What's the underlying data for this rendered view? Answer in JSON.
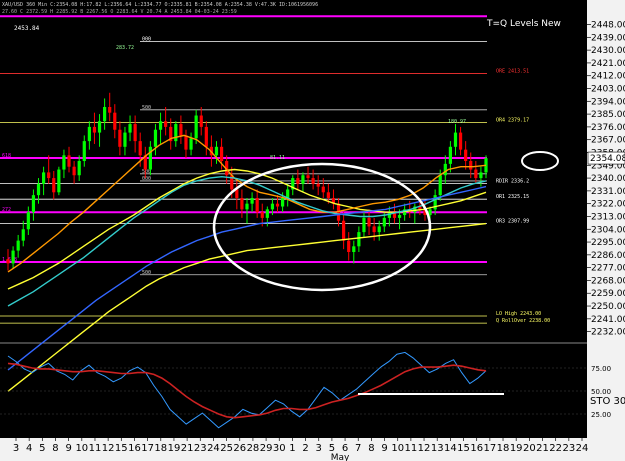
{
  "header": {
    "symbol_line": "XAU/USD 360 Min  C:2354.08  H:17.82  L:2356.64  L:2334.77  O:2335.81  B:2354.08  A:2354.38  V:47.3K  ID:1061956096",
    "sub_line": "27.60  C 2372.59  H 2285.92  B 2267.56  O 2283.64  V 20.74  A 2453.84  04-03-24  23:59",
    "top_left_value": "2453.84",
    "indicator_title": "T=Q Levels New"
  },
  "colors": {
    "background": "#000000",
    "up_candle": "#00ff00",
    "down_candle": "#ff0000",
    "pivot_line": "#ff00ff",
    "ema_yellow": "#ffff33",
    "ema_orange": "#ff9900",
    "ema_green": "#99cc33",
    "ema_cyan": "#33cccc",
    "ema_blue": "#3366ff",
    "annotation": "#ffffff",
    "stoch_fast": "#3399ff",
    "stoch_slow": "#cc2222"
  },
  "chart_data": [
    {
      "type": "candlestick",
      "title": "XAU/USD 360 Min",
      "ylim": [
        2224,
        2454
      ],
      "y_ticks": [
        2448.0,
        2439.0,
        2430.0,
        2421.0,
        2412.0,
        2403.0,
        2394.0,
        2385.0,
        2376.0,
        2367.0,
        2358.0,
        2349.0,
        2340.0,
        2331.0,
        2322.0,
        2313.0,
        2304.0,
        2295.0,
        2286.0,
        2277.0,
        2268.0,
        2259.0,
        2250.0,
        2241.0,
        2232.0
      ],
      "last_price_label": "2354.08",
      "x_dates": [
        "3",
        "4",
        "5",
        "8",
        "9",
        "10",
        "11",
        "12",
        "15",
        "16",
        "17",
        "18",
        "19",
        "21",
        "23",
        "24",
        "25",
        "26",
        "28",
        "29",
        "30",
        "1",
        "2",
        "3",
        "5",
        "6",
        "7",
        "8",
        "9",
        "10",
        "11",
        "12",
        "13",
        "14",
        "15",
        "16",
        "17",
        "18",
        "19",
        "20",
        "21",
        "22",
        "23",
        "24"
      ],
      "x_month_label": "May",
      "candles": [
        [
          2283,
          2290,
          2275,
          2280
        ],
        [
          2280,
          2292,
          2276,
          2289
        ],
        [
          2289,
          2300,
          2284,
          2296
        ],
        [
          2296,
          2310,
          2292,
          2304
        ],
        [
          2304,
          2320,
          2300,
          2316
        ],
        [
          2316,
          2332,
          2310,
          2328
        ],
        [
          2328,
          2340,
          2322,
          2336
        ],
        [
          2336,
          2348,
          2328,
          2344
        ],
        [
          2344,
          2356,
          2336,
          2340
        ],
        [
          2340,
          2345,
          2325,
          2330
        ],
        [
          2330,
          2348,
          2328,
          2346
        ],
        [
          2346,
          2360,
          2340,
          2356
        ],
        [
          2356,
          2362,
          2344,
          2348
        ],
        [
          2348,
          2352,
          2336,
          2342
        ],
        [
          2342,
          2356,
          2338,
          2352
        ],
        [
          2352,
          2370,
          2348,
          2366
        ],
        [
          2366,
          2380,
          2360,
          2376
        ],
        [
          2376,
          2386,
          2364,
          2372
        ],
        [
          2372,
          2385,
          2362,
          2380
        ],
        [
          2380,
          2396,
          2374,
          2390
        ],
        [
          2390,
          2400,
          2380,
          2386
        ],
        [
          2386,
          2392,
          2368,
          2374
        ],
        [
          2374,
          2380,
          2356,
          2362
        ],
        [
          2362,
          2376,
          2356,
          2372
        ],
        [
          2372,
          2384,
          2366,
          2378
        ],
        [
          2378,
          2384,
          2358,
          2366
        ],
        [
          2366,
          2372,
          2348,
          2356
        ],
        [
          2356,
          2362,
          2340,
          2346
        ],
        [
          2346,
          2366,
          2342,
          2362
        ],
        [
          2362,
          2378,
          2356,
          2374
        ],
        [
          2374,
          2386,
          2364,
          2380
        ],
        [
          2380,
          2390,
          2370,
          2376
        ],
        [
          2376,
          2382,
          2360,
          2366
        ],
        [
          2366,
          2380,
          2362,
          2378
        ],
        [
          2378,
          2384,
          2364,
          2370
        ],
        [
          2370,
          2374,
          2354,
          2360
        ],
        [
          2360,
          2372,
          2356,
          2368
        ],
        [
          2368,
          2388,
          2364,
          2384
        ],
        [
          2384,
          2390,
          2370,
          2376
        ],
        [
          2376,
          2380,
          2356,
          2362
        ],
        [
          2362,
          2370,
          2348,
          2356
        ],
        [
          2356,
          2366,
          2350,
          2362
        ],
        [
          2362,
          2368,
          2346,
          2352
        ],
        [
          2352,
          2356,
          2336,
          2342
        ],
        [
          2342,
          2348,
          2326,
          2332
        ],
        [
          2332,
          2338,
          2318,
          2326
        ],
        [
          2326,
          2332,
          2312,
          2318
        ],
        [
          2318,
          2326,
          2308,
          2322
        ],
        [
          2322,
          2330,
          2316,
          2326
        ],
        [
          2326,
          2332,
          2312,
          2316
        ],
        [
          2316,
          2322,
          2306,
          2312
        ],
        [
          2312,
          2320,
          2306,
          2318
        ],
        [
          2318,
          2326,
          2314,
          2322
        ],
        [
          2322,
          2328,
          2316,
          2320
        ],
        [
          2320,
          2330,
          2316,
          2326
        ],
        [
          2326,
          2336,
          2320,
          2332
        ],
        [
          2332,
          2342,
          2328,
          2340
        ],
        [
          2340,
          2346,
          2332,
          2336
        ],
        [
          2336,
          2344,
          2330,
          2342
        ],
        [
          2342,
          2348,
          2336,
          2340
        ],
        [
          2340,
          2346,
          2332,
          2336
        ],
        [
          2336,
          2342,
          2328,
          2334
        ],
        [
          2334,
          2340,
          2326,
          2330
        ],
        [
          2330,
          2336,
          2322,
          2326
        ],
        [
          2326,
          2332,
          2318,
          2322
        ],
        [
          2322,
          2326,
          2306,
          2310
        ],
        [
          2310,
          2316,
          2290,
          2296
        ],
        [
          2296,
          2302,
          2282,
          2288
        ],
        [
          2288,
          2296,
          2280,
          2292
        ],
        [
          2292,
          2306,
          2288,
          2302
        ],
        [
          2302,
          2316,
          2298,
          2312
        ],
        [
          2312,
          2318,
          2300,
          2306
        ],
        [
          2306,
          2312,
          2296,
          2302
        ],
        [
          2302,
          2310,
          2296,
          2306
        ],
        [
          2306,
          2316,
          2302,
          2312
        ],
        [
          2312,
          2320,
          2306,
          2316
        ],
        [
          2316,
          2322,
          2308,
          2312
        ],
        [
          2312,
          2318,
          2304,
          2314
        ],
        [
          2314,
          2322,
          2310,
          2318
        ],
        [
          2318,
          2324,
          2312,
          2316
        ],
        [
          2316,
          2322,
          2308,
          2320
        ],
        [
          2320,
          2326,
          2314,
          2318
        ],
        [
          2318,
          2324,
          2310,
          2314
        ],
        [
          2314,
          2320,
          2308,
          2318
        ],
        [
          2318,
          2332,
          2314,
          2328
        ],
        [
          2328,
          2346,
          2324,
          2342
        ],
        [
          2342,
          2356,
          2336,
          2350
        ],
        [
          2350,
          2366,
          2344,
          2362
        ],
        [
          2362,
          2378,
          2356,
          2372
        ],
        [
          2372,
          2376,
          2356,
          2360
        ],
        [
          2360,
          2366,
          2346,
          2352
        ],
        [
          2352,
          2358,
          2340,
          2346
        ],
        [
          2346,
          2352,
          2336,
          2340
        ],
        [
          2340,
          2348,
          2334,
          2344
        ],
        [
          2344,
          2356,
          2340,
          2354
        ]
      ],
      "moving_averages": [
        {
          "name": "EMA yellow",
          "values": [
            2262,
            2266,
            2270,
            2275,
            2280,
            2286,
            2292,
            2298,
            2304,
            2309,
            2314,
            2320,
            2326,
            2331,
            2336,
            2340,
            2343,
            2345,
            2346,
            2345,
            2343,
            2340,
            2336,
            2332,
            2328,
            2325,
            2322,
            2320,
            2318,
            2317,
            2316,
            2316,
            2317,
            2318,
            2320,
            2322,
            2324,
            2327,
            2330
          ]
        },
        {
          "name": "EMA orange",
          "values": [
            2274,
            2280,
            2287,
            2294,
            2301,
            2309,
            2316,
            2324,
            2332,
            2340,
            2348,
            2356,
            2363,
            2368,
            2370,
            2367,
            2360,
            2350,
            2340,
            2334,
            2330,
            2328,
            2326,
            2322,
            2318,
            2316,
            2316,
            2318,
            2320,
            2322,
            2323,
            2325,
            2328,
            2333,
            2340,
            2346,
            2348,
            2348,
            2349
          ]
        },
        {
          "name": "EMA cyan",
          "values": [
            2250,
            2255,
            2260,
            2266,
            2272,
            2278,
            2284,
            2291,
            2298,
            2305,
            2312,
            2318,
            2324,
            2330,
            2335,
            2338,
            2340,
            2341,
            2340,
            2338,
            2335,
            2331,
            2327,
            2323,
            2320,
            2317,
            2315,
            2314,
            2313,
            2313,
            2314,
            2316,
            2318,
            2321,
            2325,
            2329,
            2333,
            2336,
            2338
          ]
        },
        {
          "name": "EMA blue",
          "values": [
            2205,
            2212,
            2219,
            2226,
            2233,
            2240,
            2247,
            2254,
            2260,
            2266,
            2272,
            2278,
            2283,
            2288,
            2292,
            2296,
            2299,
            2302,
            2304,
            2306,
            2308,
            2309,
            2310,
            2311,
            2312,
            2313,
            2314,
            2315,
            2316,
            2317,
            2318,
            2320,
            2322,
            2324,
            2326,
            2328,
            2330,
            2332,
            2334
          ]
        },
        {
          "name": "SMA yellow slow",
          "values": [
            2190,
            2197,
            2204,
            2211,
            2218,
            2225,
            2232,
            2239,
            2246,
            2252,
            2258,
            2264,
            2269,
            2273,
            2277,
            2280,
            2283,
            2285,
            2287,
            2289,
            2290,
            2291,
            2292,
            2293,
            2294,
            2295,
            2296,
            2297,
            2298,
            2299,
            2300,
            2301,
            2302,
            2303,
            2304,
            2305,
            2306,
            2307,
            2308
          ]
        }
      ],
      "levels": [
        {
          "label": "",
          "price": 2453.84,
          "color": "#ff00ff"
        },
        {
          "label": "000",
          "price": 2436.0,
          "color": "#ffffff"
        },
        {
          "label": "ORE 2413.51",
          "price": 2413.51,
          "color": "#ff3333"
        },
        {
          "label": "500",
          "price": 2388.0,
          "color": "#cccccc"
        },
        {
          "label": "OR4 2379.17",
          "price": 2379.17,
          "color": "#ffff66"
        },
        {
          "label": "618",
          "price": 2354.08,
          "color": "#ff00ff"
        },
        {
          "label": "500",
          "price": 2343.0,
          "color": "#cccccc"
        },
        {
          "label": "000",
          "price": 2338.0,
          "color": "#cccccc"
        },
        {
          "label": "RDIR 2336.2",
          "price": 2336.2,
          "color": "#ffffff"
        },
        {
          "label": "OR1 2325.15",
          "price": 2325.15,
          "color": "#ffffff"
        },
        {
          "label": "272",
          "price": 2316.0,
          "color": "#ff00ff"
        },
        {
          "label": "OR3 2307.99",
          "price": 2307.99,
          "color": "#ffffff"
        },
        {
          "label": "1.618",
          "price": 2281.0,
          "color": "#ff00ff"
        },
        {
          "label": "500",
          "price": 2272.0,
          "color": "#cccccc"
        },
        {
          "label": "LO High 2243.00",
          "price": 2243.0,
          "color": "#ffff66"
        },
        {
          "label": "Q RollOver 2238.00",
          "price": 2238.0,
          "color": "#ffff66"
        }
      ],
      "annotations": [
        "283.72",
        "180.97",
        "81.11"
      ]
    },
    {
      "type": "line",
      "title": "STO 30",
      "ylim": [
        0,
        100
      ],
      "y_ticks": [
        75.0,
        50.0,
        25.0
      ],
      "series": [
        {
          "name": "%K",
          "values": [
            88,
            82,
            74,
            70,
            76,
            80,
            72,
            68,
            62,
            72,
            78,
            70,
            66,
            60,
            64,
            72,
            76,
            70,
            56,
            44,
            30,
            22,
            14,
            20,
            26,
            18,
            10,
            16,
            22,
            30,
            26,
            24,
            32,
            40,
            36,
            28,
            22,
            30,
            42,
            54,
            48,
            40,
            46,
            52,
            60,
            68,
            76,
            82,
            90,
            92,
            86,
            78,
            70,
            74,
            80,
            84,
            70,
            58,
            64,
            72
          ]
        },
        {
          "name": "%D",
          "values": [
            80,
            79,
            77,
            75,
            74,
            74,
            73,
            72,
            71,
            71,
            72,
            72,
            71,
            70,
            69,
            69,
            70,
            70,
            68,
            64,
            58,
            51,
            44,
            38,
            33,
            29,
            25,
            22,
            21,
            22,
            23,
            24,
            26,
            29,
            31,
            31,
            30,
            30,
            32,
            35,
            38,
            40,
            42,
            45,
            48,
            52,
            56,
            61,
            66,
            71,
            74,
            76,
            76,
            76,
            77,
            78,
            77,
            75,
            73,
            72
          ]
        }
      ]
    }
  ]
}
